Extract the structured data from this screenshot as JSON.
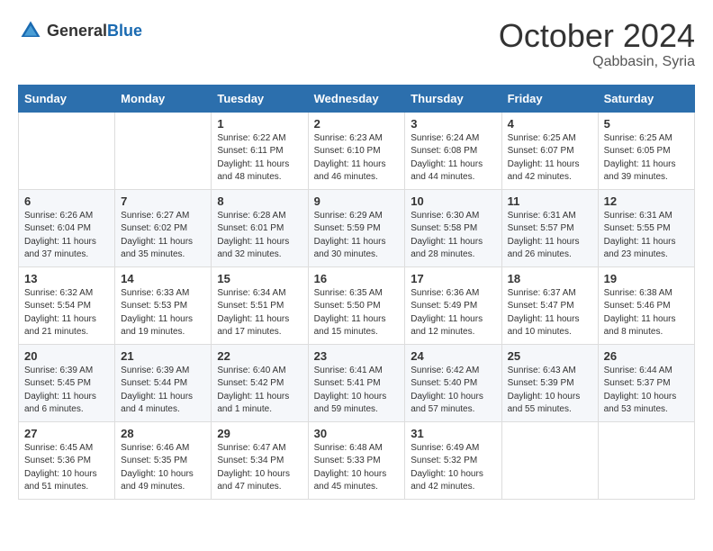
{
  "header": {
    "logo_general": "General",
    "logo_blue": "Blue",
    "month_title": "October 2024",
    "location": "Qabbasin, Syria"
  },
  "weekdays": [
    "Sunday",
    "Monday",
    "Tuesday",
    "Wednesday",
    "Thursday",
    "Friday",
    "Saturday"
  ],
  "weeks": [
    [
      {
        "day": "",
        "sunrise": "",
        "sunset": "",
        "daylight": ""
      },
      {
        "day": "",
        "sunrise": "",
        "sunset": "",
        "daylight": ""
      },
      {
        "day": "1",
        "sunrise": "Sunrise: 6:22 AM",
        "sunset": "Sunset: 6:11 PM",
        "daylight": "Daylight: 11 hours and 48 minutes."
      },
      {
        "day": "2",
        "sunrise": "Sunrise: 6:23 AM",
        "sunset": "Sunset: 6:10 PM",
        "daylight": "Daylight: 11 hours and 46 minutes."
      },
      {
        "day": "3",
        "sunrise": "Sunrise: 6:24 AM",
        "sunset": "Sunset: 6:08 PM",
        "daylight": "Daylight: 11 hours and 44 minutes."
      },
      {
        "day": "4",
        "sunrise": "Sunrise: 6:25 AM",
        "sunset": "Sunset: 6:07 PM",
        "daylight": "Daylight: 11 hours and 42 minutes."
      },
      {
        "day": "5",
        "sunrise": "Sunrise: 6:25 AM",
        "sunset": "Sunset: 6:05 PM",
        "daylight": "Daylight: 11 hours and 39 minutes."
      }
    ],
    [
      {
        "day": "6",
        "sunrise": "Sunrise: 6:26 AM",
        "sunset": "Sunset: 6:04 PM",
        "daylight": "Daylight: 11 hours and 37 minutes."
      },
      {
        "day": "7",
        "sunrise": "Sunrise: 6:27 AM",
        "sunset": "Sunset: 6:02 PM",
        "daylight": "Daylight: 11 hours and 35 minutes."
      },
      {
        "day": "8",
        "sunrise": "Sunrise: 6:28 AM",
        "sunset": "Sunset: 6:01 PM",
        "daylight": "Daylight: 11 hours and 32 minutes."
      },
      {
        "day": "9",
        "sunrise": "Sunrise: 6:29 AM",
        "sunset": "Sunset: 5:59 PM",
        "daylight": "Daylight: 11 hours and 30 minutes."
      },
      {
        "day": "10",
        "sunrise": "Sunrise: 6:30 AM",
        "sunset": "Sunset: 5:58 PM",
        "daylight": "Daylight: 11 hours and 28 minutes."
      },
      {
        "day": "11",
        "sunrise": "Sunrise: 6:31 AM",
        "sunset": "Sunset: 5:57 PM",
        "daylight": "Daylight: 11 hours and 26 minutes."
      },
      {
        "day": "12",
        "sunrise": "Sunrise: 6:31 AM",
        "sunset": "Sunset: 5:55 PM",
        "daylight": "Daylight: 11 hours and 23 minutes."
      }
    ],
    [
      {
        "day": "13",
        "sunrise": "Sunrise: 6:32 AM",
        "sunset": "Sunset: 5:54 PM",
        "daylight": "Daylight: 11 hours and 21 minutes."
      },
      {
        "day": "14",
        "sunrise": "Sunrise: 6:33 AM",
        "sunset": "Sunset: 5:53 PM",
        "daylight": "Daylight: 11 hours and 19 minutes."
      },
      {
        "day": "15",
        "sunrise": "Sunrise: 6:34 AM",
        "sunset": "Sunset: 5:51 PM",
        "daylight": "Daylight: 11 hours and 17 minutes."
      },
      {
        "day": "16",
        "sunrise": "Sunrise: 6:35 AM",
        "sunset": "Sunset: 5:50 PM",
        "daylight": "Daylight: 11 hours and 15 minutes."
      },
      {
        "day": "17",
        "sunrise": "Sunrise: 6:36 AM",
        "sunset": "Sunset: 5:49 PM",
        "daylight": "Daylight: 11 hours and 12 minutes."
      },
      {
        "day": "18",
        "sunrise": "Sunrise: 6:37 AM",
        "sunset": "Sunset: 5:47 PM",
        "daylight": "Daylight: 11 hours and 10 minutes."
      },
      {
        "day": "19",
        "sunrise": "Sunrise: 6:38 AM",
        "sunset": "Sunset: 5:46 PM",
        "daylight": "Daylight: 11 hours and 8 minutes."
      }
    ],
    [
      {
        "day": "20",
        "sunrise": "Sunrise: 6:39 AM",
        "sunset": "Sunset: 5:45 PM",
        "daylight": "Daylight: 11 hours and 6 minutes."
      },
      {
        "day": "21",
        "sunrise": "Sunrise: 6:39 AM",
        "sunset": "Sunset: 5:44 PM",
        "daylight": "Daylight: 11 hours and 4 minutes."
      },
      {
        "day": "22",
        "sunrise": "Sunrise: 6:40 AM",
        "sunset": "Sunset: 5:42 PM",
        "daylight": "Daylight: 11 hours and 1 minute."
      },
      {
        "day": "23",
        "sunrise": "Sunrise: 6:41 AM",
        "sunset": "Sunset: 5:41 PM",
        "daylight": "Daylight: 10 hours and 59 minutes."
      },
      {
        "day": "24",
        "sunrise": "Sunrise: 6:42 AM",
        "sunset": "Sunset: 5:40 PM",
        "daylight": "Daylight: 10 hours and 57 minutes."
      },
      {
        "day": "25",
        "sunrise": "Sunrise: 6:43 AM",
        "sunset": "Sunset: 5:39 PM",
        "daylight": "Daylight: 10 hours and 55 minutes."
      },
      {
        "day": "26",
        "sunrise": "Sunrise: 6:44 AM",
        "sunset": "Sunset: 5:37 PM",
        "daylight": "Daylight: 10 hours and 53 minutes."
      }
    ],
    [
      {
        "day": "27",
        "sunrise": "Sunrise: 6:45 AM",
        "sunset": "Sunset: 5:36 PM",
        "daylight": "Daylight: 10 hours and 51 minutes."
      },
      {
        "day": "28",
        "sunrise": "Sunrise: 6:46 AM",
        "sunset": "Sunset: 5:35 PM",
        "daylight": "Daylight: 10 hours and 49 minutes."
      },
      {
        "day": "29",
        "sunrise": "Sunrise: 6:47 AM",
        "sunset": "Sunset: 5:34 PM",
        "daylight": "Daylight: 10 hours and 47 minutes."
      },
      {
        "day": "30",
        "sunrise": "Sunrise: 6:48 AM",
        "sunset": "Sunset: 5:33 PM",
        "daylight": "Daylight: 10 hours and 45 minutes."
      },
      {
        "day": "31",
        "sunrise": "Sunrise: 6:49 AM",
        "sunset": "Sunset: 5:32 PM",
        "daylight": "Daylight: 10 hours and 42 minutes."
      },
      {
        "day": "",
        "sunrise": "",
        "sunset": "",
        "daylight": ""
      },
      {
        "day": "",
        "sunrise": "",
        "sunset": "",
        "daylight": ""
      }
    ]
  ]
}
